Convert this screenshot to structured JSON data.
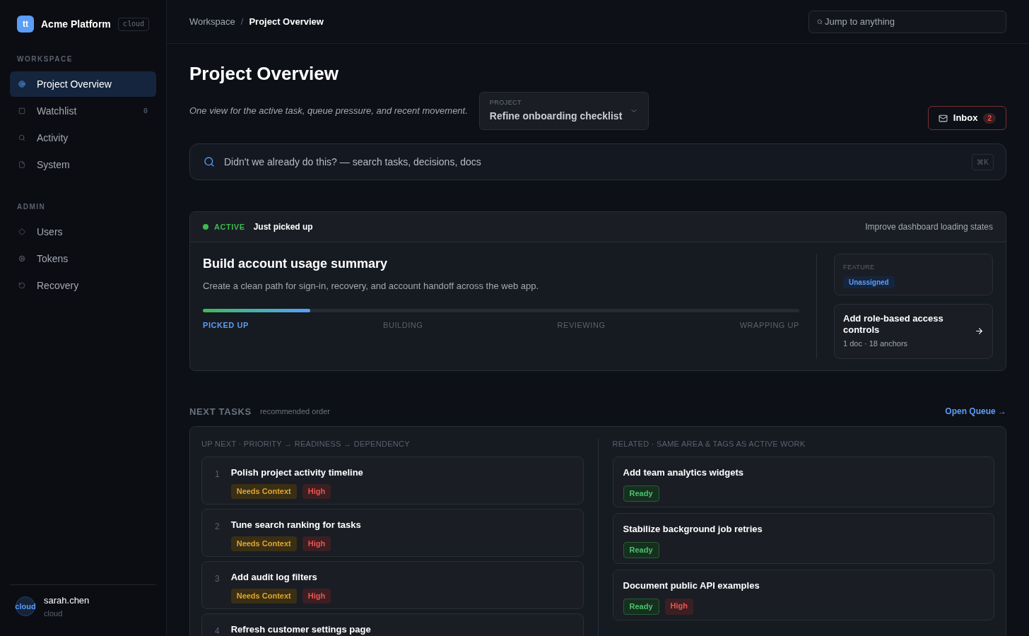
{
  "sidebar": {
    "logo": "tt",
    "brand": "Acme Platform",
    "env_badge": "cloud",
    "sections": [
      {
        "title": "WORKSPACE",
        "items": [
          {
            "label": "Project Overview",
            "selected": true
          },
          {
            "label": "Watchlist",
            "selected": false,
            "count": "0"
          },
          {
            "label": "Activity",
            "selected": false
          },
          {
            "label": "System",
            "selected": false
          }
        ]
      },
      {
        "title": "ADMIN",
        "items": [
          {
            "label": "Users",
            "selected": false
          },
          {
            "label": "Tokens",
            "selected": false
          },
          {
            "label": "Recovery",
            "selected": false
          }
        ]
      }
    ],
    "user": {
      "avatar": "cloud",
      "name": "sarah.chen",
      "subtitle": "cloud"
    }
  },
  "header": {
    "separator": "/",
    "breadcrumbs": [
      {
        "label": "Workspace",
        "selected": false
      },
      {
        "label": "Project Overview",
        "selected": true
      }
    ],
    "jump": {
      "placeholder": "Jump to anything"
    }
  },
  "page": {
    "title": "Project Overview",
    "subtitle": "One view for the active task, queue pressure, and recent movement.",
    "project_select": {
      "label": "PROJECT",
      "value": "Refine onboarding checklist"
    },
    "inbox": {
      "label": "Inbox",
      "count": "2"
    },
    "search": {
      "placeholder": "Didn't we already do this? — search tasks, decisions, docs",
      "shortcut": "⌘K"
    }
  },
  "active_card": {
    "status": "ACTIVE",
    "status_note": "Just picked up",
    "related": "Improve dashboard loading states",
    "title": "Build account usage summary",
    "description": "Create a clean path for sign-in, recovery, and account handoff across the web app.",
    "level": 0.18,
    "stages": [
      {
        "label": "PICKED UP",
        "selected": true
      },
      {
        "label": "BUILDING",
        "selected": false
      },
      {
        "label": "REVIEWING",
        "selected": false
      },
      {
        "label": "WRAPPING UP",
        "selected": false
      }
    ],
    "feature": {
      "label": "FEATURE",
      "value": "Unassigned"
    },
    "doc_link": {
      "title": "Add role-based access controls",
      "meta": "1 doc · 18 anchors"
    }
  },
  "next_tasks": {
    "title": "NEXT TASKS",
    "note": "recommended order",
    "link": "Open Queue →",
    "up_next": {
      "heading": "UP NEXT · PRIORITY → READINESS → DEPENDENCY",
      "items": [
        {
          "number": "1",
          "title": "Polish project activity timeline",
          "tags": [
            {
              "label": "Needs Context",
              "kind": "context"
            },
            {
              "label": "High",
              "kind": "high"
            }
          ]
        },
        {
          "number": "2",
          "title": "Tune search ranking for tasks",
          "tags": [
            {
              "label": "Needs Context",
              "kind": "context"
            },
            {
              "label": "High",
              "kind": "high"
            }
          ]
        },
        {
          "number": "3",
          "title": "Add audit log filters",
          "tags": [
            {
              "label": "Needs Context",
              "kind": "context"
            },
            {
              "label": "High",
              "kind": "high"
            }
          ]
        },
        {
          "number": "4",
          "title": "Refresh customer settings page"
        }
      ]
    },
    "related": {
      "heading": "RELATED · SAME AREA & TAGS AS ACTIVE WORK",
      "items": [
        {
          "title": "Add team analytics widgets",
          "tags": [
            {
              "label": "Ready",
              "kind": "ready"
            }
          ]
        },
        {
          "title": "Stabilize background job retries",
          "tags": [
            {
              "label": "Ready",
              "kind": "ready"
            }
          ]
        },
        {
          "title": "Document public API examples",
          "tags": [
            {
              "label": "Ready",
              "kind": "ready"
            },
            {
              "label": "High",
              "kind": "high"
            }
          ]
        }
      ]
    }
  }
}
